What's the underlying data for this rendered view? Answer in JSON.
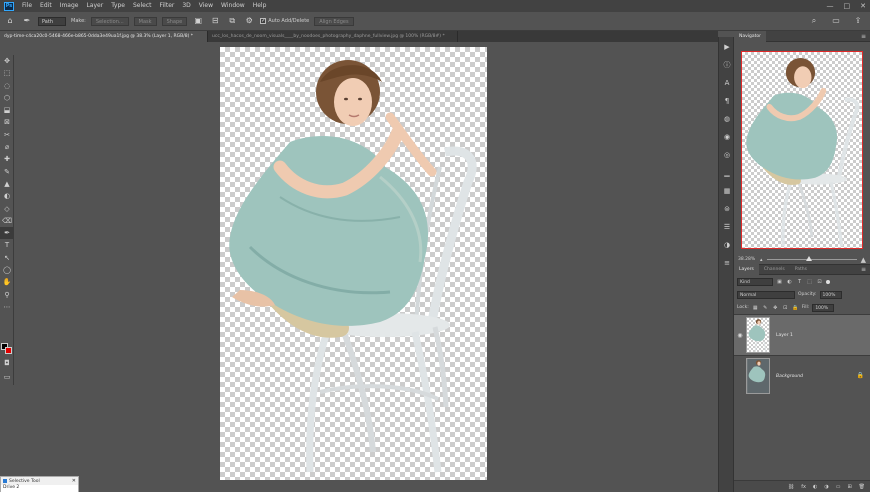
{
  "app": {
    "logo_text": "Ps"
  },
  "menu": [
    "File",
    "Edit",
    "Image",
    "Layer",
    "Type",
    "Select",
    "Filter",
    "3D",
    "View",
    "Window",
    "Help"
  ],
  "window_controls": [
    "—",
    "□",
    "✕"
  ],
  "options_bar": {
    "mode_select": "Path",
    "make_label": "Make:",
    "selection_btn": "Selection...",
    "mask_btn": "Mask",
    "shape_btn": "Shape",
    "auto_add_delete_label": "Auto Add/Delete",
    "auto_add_delete_checked": "✓",
    "align_edges": "Align Edges"
  },
  "tabs": [
    {
      "label": "dyp-time-c4ca20c0-5468-466e-b865-0dda3e49ua1f.jpg @ 38.3% (Layer 1, RGB/8) *",
      "active": true
    },
    {
      "label": "ucc_los_hacos_de_noom_visuals____by_noodoes_photography_daphne_fullview.jpg @ 100% (RGB/8#) *",
      "active": false
    }
  ],
  "tools": [
    "✥",
    "⬚",
    "◌",
    "⬡",
    "⬓",
    "⊠",
    "✂",
    "⌀",
    "✚",
    "✎",
    "▲",
    "◐",
    "◇",
    "⌫",
    "✒",
    "T",
    "↖",
    "◯",
    "✋",
    "⚲",
    "⋯"
  ],
  "navigator": {
    "tab": "Navigator",
    "zoom": "38.28%"
  },
  "layers": {
    "tabs": [
      "Layers",
      "Channels",
      "Paths"
    ],
    "filter_kind": "Kind",
    "blend_mode": "Normal",
    "opacity_label": "Opacity:",
    "opacity_value": "100%",
    "lock_label": "Lock:",
    "fill_label": "Fill:",
    "fill_value": "100%",
    "items": [
      {
        "name": "Layer 1",
        "selected": true,
        "visible": true
      },
      {
        "name": "Background",
        "selected": false,
        "visible": false
      }
    ],
    "footer_icons": [
      "⛓",
      "fx",
      "◐",
      "◑",
      "▭",
      "⊞",
      "🗑"
    ]
  },
  "floating": {
    "title": "Selective Tool",
    "subtitle": "Drive 2"
  },
  "colors": {
    "foreground": "#000000",
    "background": "#e00000",
    "accent": "#31a8ff"
  }
}
